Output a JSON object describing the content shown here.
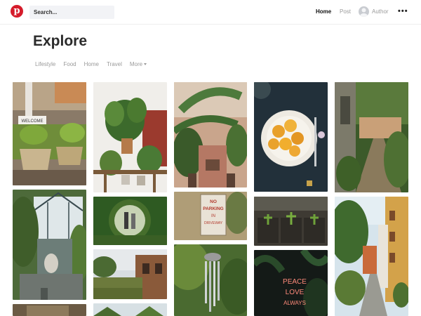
{
  "header": {
    "logo_letter": "p",
    "search_placeholder": "Search...",
    "nav": {
      "home": "Home",
      "post": "Post",
      "author": "Author"
    },
    "more_menu": "•••"
  },
  "page": {
    "title": "Explore",
    "categories": [
      "Lifestyle",
      "Food",
      "Home",
      "Travel"
    ],
    "more_label": "More"
  },
  "sign_text": [
    "NO",
    "PARKING",
    "IN",
    "DRIVEWAY"
  ],
  "neon_text": [
    "PEACE",
    "LOVE",
    "ALWAYS"
  ],
  "welcome_sign": "WELCOME",
  "colors": {
    "brand": "#d51c2b",
    "search_bg": "#f2f3f6",
    "muted": "#9a9a9a"
  }
}
